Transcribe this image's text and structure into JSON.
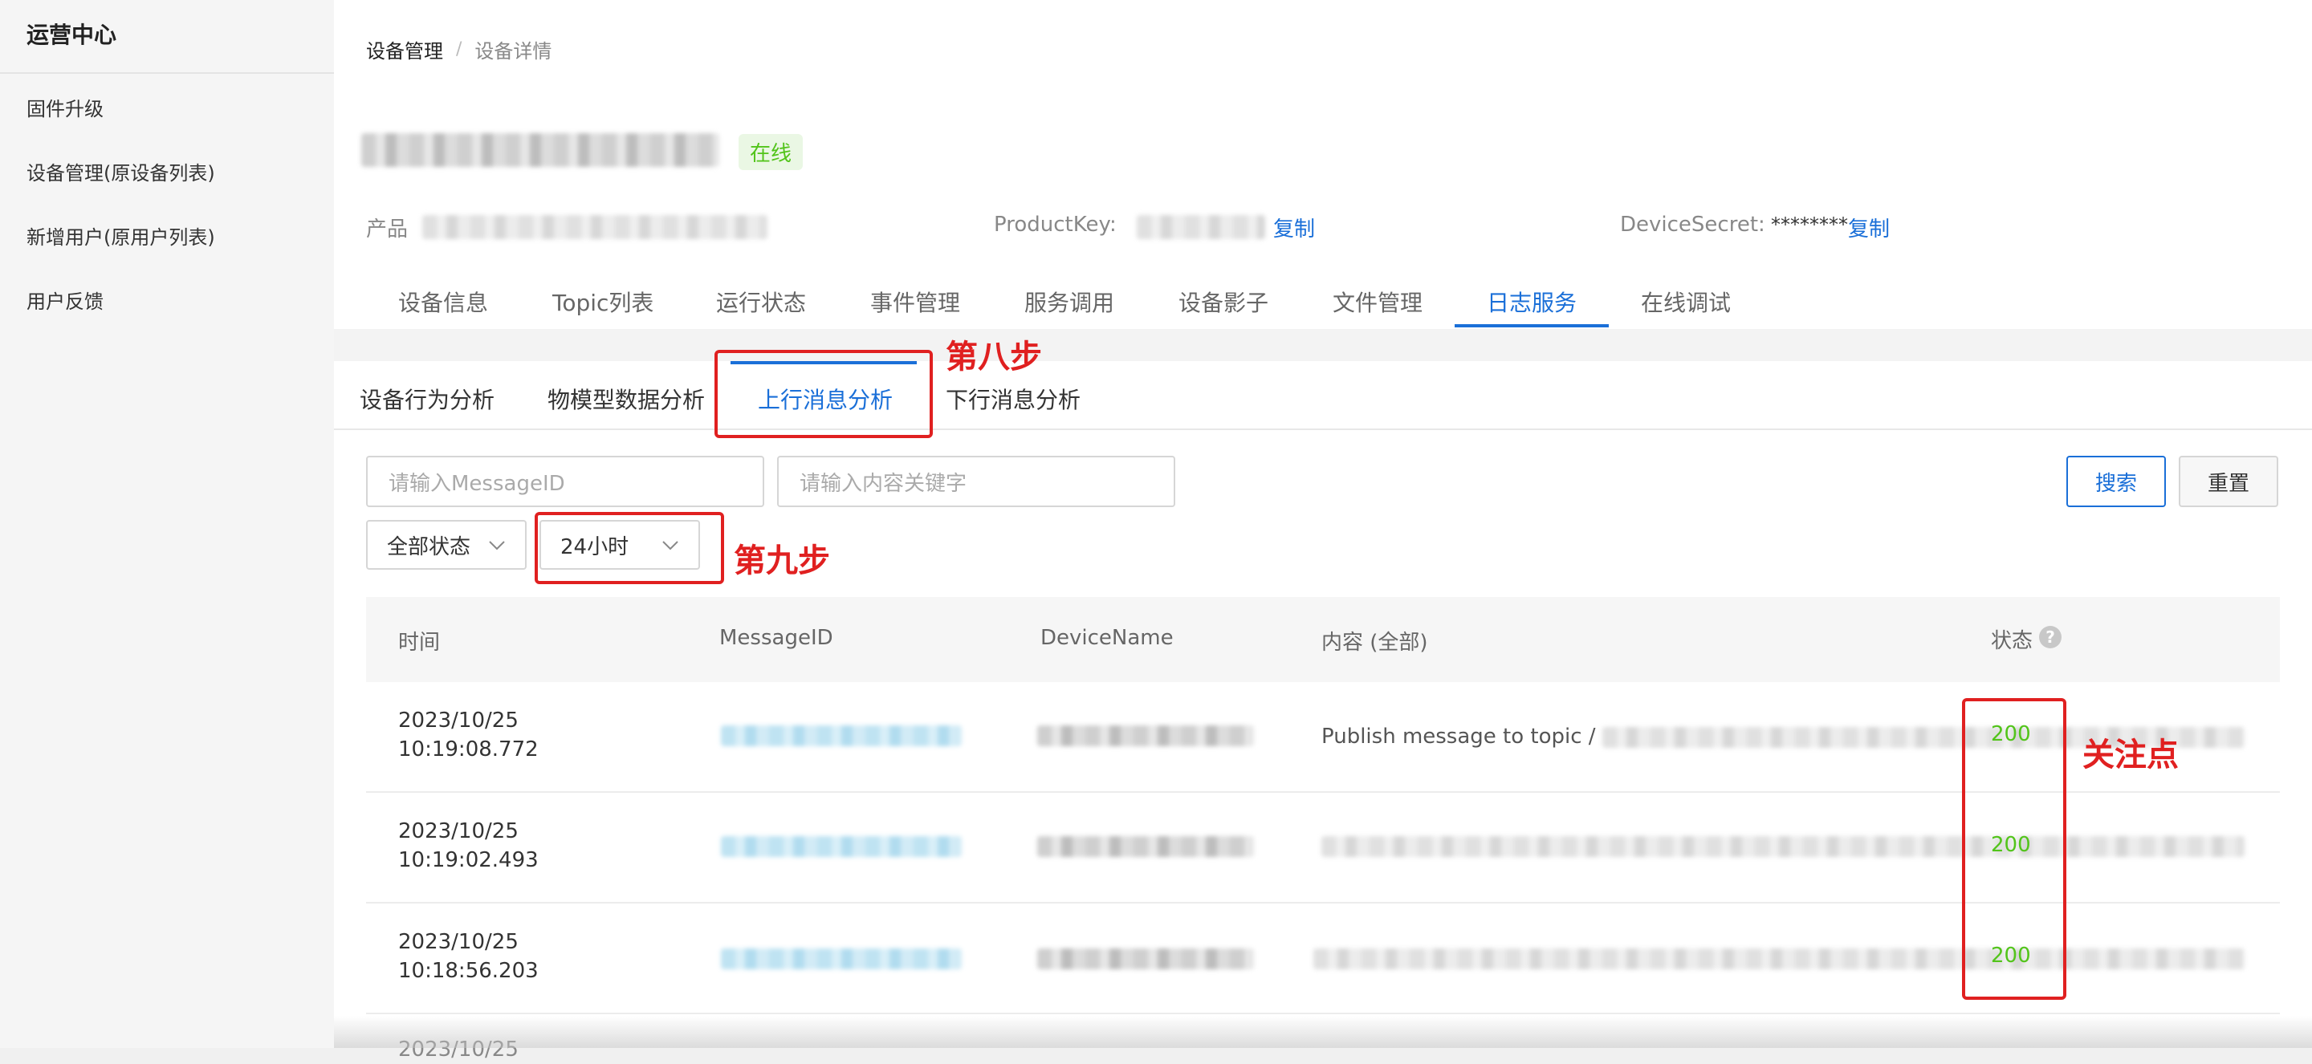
{
  "sidebar": {
    "title": "运营中心",
    "items": [
      "固件升级",
      "设备管理(原设备列表)",
      "新增用户(原用户列表)",
      "用户反馈"
    ]
  },
  "breadcrumb": {
    "parent": "设备管理",
    "separator": "/",
    "current": "设备详情"
  },
  "device": {
    "status_badge": "在线",
    "product_label": "产品",
    "product_key_label": "ProductKey:",
    "copy_label": "复制",
    "device_secret_label": "DeviceSecret:",
    "device_secret_value": "********",
    "copy_label_2": "复制"
  },
  "tabs": [
    "设备信息",
    "Topic列表",
    "运行状态",
    "事件管理",
    "服务调用",
    "设备影子",
    "文件管理",
    "日志服务",
    "在线调试"
  ],
  "active_tab": "日志服务",
  "subtabs": [
    "设备行为分析",
    "物模型数据分析",
    "上行消息分析",
    "下行消息分析"
  ],
  "active_subtab": "上行消息分析",
  "filters": {
    "message_id_placeholder": "请输入MessageID",
    "keyword_placeholder": "请输入内容关键字",
    "search_button": "搜索",
    "reset_button": "重置",
    "status_select": "全部状态",
    "time_select": "24小时"
  },
  "table": {
    "headers": [
      "时间",
      "MessageID",
      "DeviceName",
      "内容 (全部)",
      "状态"
    ],
    "rows": [
      {
        "date": "2023/10/25",
        "time": "10:19:08.772",
        "content_prefix": "Publish message to topic /",
        "status": "200"
      },
      {
        "date": "2023/10/25",
        "time": "10:19:02.493",
        "content_prefix": "",
        "status": "200"
      },
      {
        "date": "2023/10/25",
        "time": "10:18:56.203",
        "content_prefix": "",
        "status": "200"
      }
    ],
    "partial_row": {
      "date": "2023/10/25"
    }
  },
  "annotations": {
    "step8": "第八步",
    "step9": "第九步",
    "focus": "关注点",
    "color": "#e02020"
  },
  "colors": {
    "accent": "#1a6fd8",
    "success": "#52c41a"
  }
}
